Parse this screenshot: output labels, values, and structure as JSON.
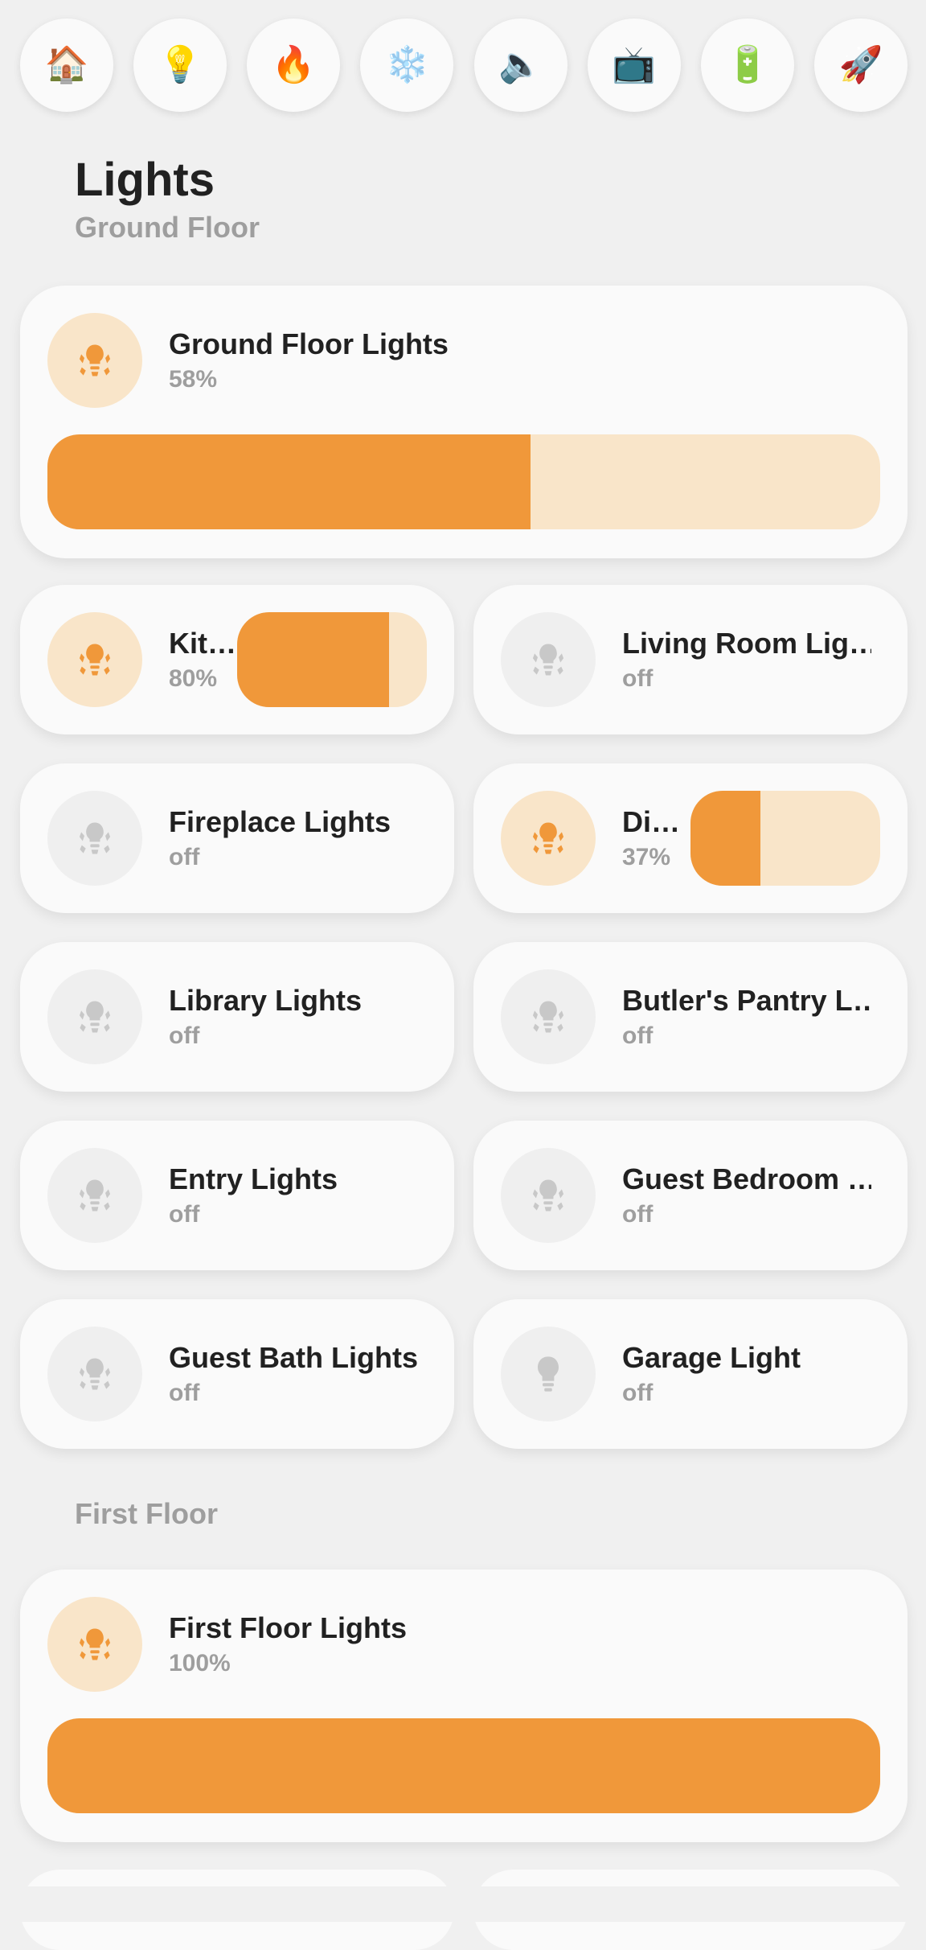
{
  "nav": [
    {
      "icon": "🏠",
      "name": "home-icon"
    },
    {
      "icon": "💡",
      "name": "lightbulb-icon"
    },
    {
      "icon": "🔥",
      "name": "fire-icon"
    },
    {
      "icon": "❄️",
      "name": "snowflake-icon"
    },
    {
      "icon": "🔈",
      "name": "speaker-icon"
    },
    {
      "icon": "📺",
      "name": "television-icon"
    },
    {
      "icon": "🔋",
      "name": "battery-icon"
    },
    {
      "icon": "🚀",
      "name": "rocket-icon"
    }
  ],
  "page": {
    "title": "Lights"
  },
  "sections": {
    "ground": {
      "title": "Ground Floor",
      "group": {
        "name": "Ground Floor Lights",
        "state": "58%",
        "level": 0.58
      },
      "lights": [
        {
          "name": "Kit…",
          "state": "80%",
          "level": 0.8
        },
        {
          "name": "Living Room Lig…",
          "state": "off"
        },
        {
          "name": "Fireplace Lights",
          "state": "off"
        },
        {
          "name": "Di…",
          "state": "37%",
          "level": 0.37
        },
        {
          "name": "Library Lights",
          "state": "off"
        },
        {
          "name": "Butler's Pantry L…",
          "state": "off"
        },
        {
          "name": "Entry Lights",
          "state": "off"
        },
        {
          "name": "Guest Bedroom …",
          "state": "off"
        },
        {
          "name": "Guest Bath Lights",
          "state": "off"
        },
        {
          "name": "Garage Light",
          "state": "off"
        }
      ]
    },
    "first": {
      "title": "First Floor",
      "group": {
        "name": "First Floor Lights",
        "state": "100%",
        "level": 1.0
      }
    }
  },
  "colors": {
    "accent": "#f0983a",
    "accent_light": "#f9e5c9",
    "off_icon": "#c8c8c8",
    "background": "#f0f0f0",
    "card": "#fafafa"
  }
}
